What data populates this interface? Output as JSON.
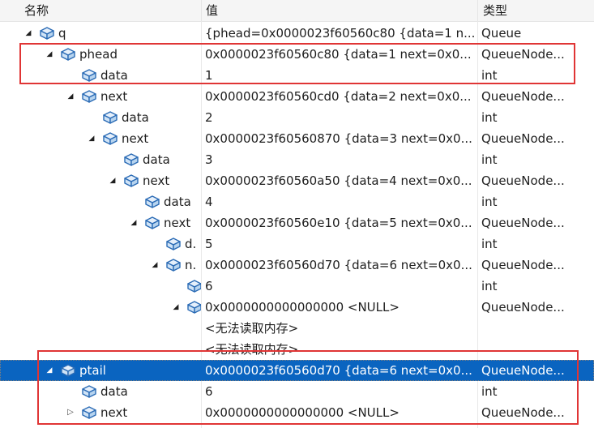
{
  "columns": {
    "name": "名称",
    "value": "值",
    "type": "类型"
  },
  "rows": [
    {
      "name": "q",
      "value": "{phead=0x0000023f60560c80 {data=1 n...",
      "type": "Queue",
      "depth": 0,
      "expand": "expanded"
    },
    {
      "name": "phead",
      "value": "0x0000023f60560c80 {data=1 next=0x0...",
      "type": "QueueNode...",
      "depth": 1,
      "expand": "expanded"
    },
    {
      "name": "data",
      "value": "1",
      "type": "int",
      "depth": 2,
      "expand": "none"
    },
    {
      "name": "next",
      "value": "0x0000023f60560cd0 {data=2 next=0x0...",
      "type": "QueueNode...",
      "depth": 2,
      "expand": "expanded"
    },
    {
      "name": "data",
      "value": "2",
      "type": "int",
      "depth": 3,
      "expand": "none"
    },
    {
      "name": "next",
      "value": "0x0000023f60560870 {data=3 next=0x0...",
      "type": "QueueNode...",
      "depth": 3,
      "expand": "expanded"
    },
    {
      "name": "data",
      "value": "3",
      "type": "int",
      "depth": 4,
      "expand": "none"
    },
    {
      "name": "next",
      "value": "0x0000023f60560a50 {data=4 next=0x0...",
      "type": "QueueNode...",
      "depth": 4,
      "expand": "expanded"
    },
    {
      "name": "data",
      "value": "4",
      "type": "int",
      "depth": 5,
      "expand": "none"
    },
    {
      "name": "next",
      "value": "0x0000023f60560e10 {data=5 next=0x0...",
      "type": "QueueNode...",
      "depth": 5,
      "expand": "expanded"
    },
    {
      "name": "d.",
      "value": "5",
      "type": "int",
      "depth": 6,
      "expand": "none"
    },
    {
      "name": "n.",
      "value": "0x0000023f60560d70 {data=6 next=0x0...",
      "type": "QueueNode...",
      "depth": 6,
      "expand": "expanded"
    },
    {
      "name": "",
      "value": "6",
      "type": "int",
      "depth": 7,
      "expand": "none"
    },
    {
      "name": "",
      "value": "0x0000000000000000 <NULL>",
      "type": "QueueNode...",
      "depth": 7,
      "expand": "expanded"
    },
    {
      "name": "",
      "value": "<无法读取内存>",
      "type": "",
      "depth": 8,
      "expand": "none",
      "noicon": true
    },
    {
      "name": "",
      "value": "<无法读取内存>",
      "type": "",
      "depth": 8,
      "expand": "none",
      "noicon": true
    },
    {
      "name": "ptail",
      "value": "0x0000023f60560d70 {data=6 next=0x0...",
      "type": "QueueNode...",
      "depth": 1,
      "expand": "expanded",
      "selected": true
    },
    {
      "name": "data",
      "value": "6",
      "type": "int",
      "depth": 2,
      "expand": "none"
    },
    {
      "name": "next",
      "value": "0x0000000000000000 <NULL>",
      "type": "QueueNode...",
      "depth": 2,
      "expand": "collapsed"
    }
  ],
  "icon": "field-cube-icon",
  "colors": {
    "selection": "#0a64c0",
    "highlight_box": "#e03535",
    "icon_stroke": "#2a6bb5",
    "icon_fill": "#cfe3f6"
  }
}
